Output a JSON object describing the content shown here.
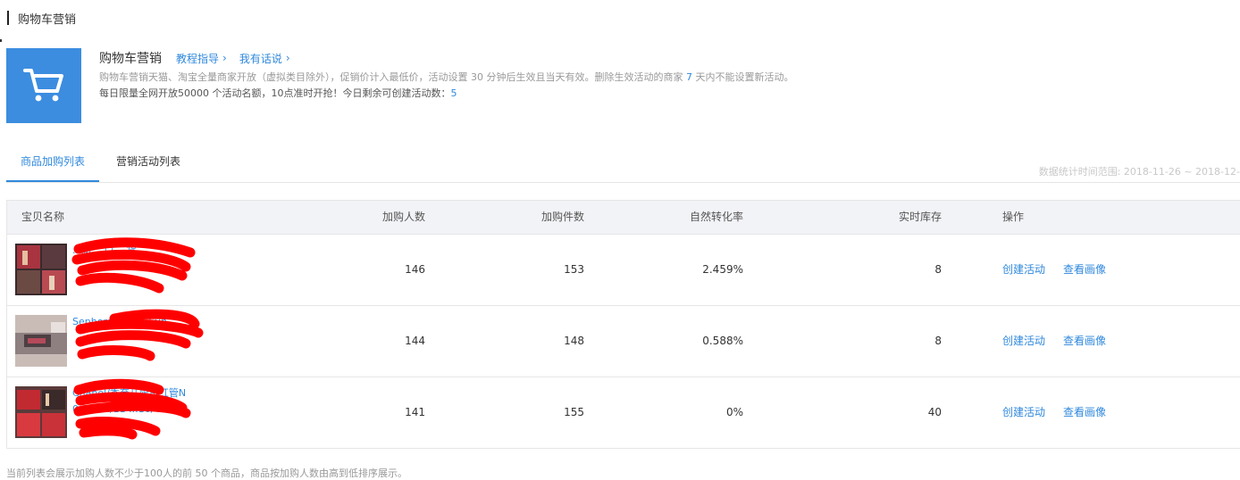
{
  "page": {
    "title": "购物车营销"
  },
  "promo": {
    "title": "购物车营销",
    "links": [
      "教程指导",
      "我有话说"
    ],
    "desc_pre": "购物车营销天猫、淘宝全量商家开放（虚拟类目除外），促销价计入最低价，活动设置 30 分钟后生效且当天有效。删除生效活动的商家 ",
    "desc_num": "7",
    "desc_post": " 天内不能设置新活动。",
    "quota_pre": "每日限量全网开放50000 个活动名额，10点准时开抢！今日剩余可创建活动数：",
    "quota_num": "5"
  },
  "tabs": [
    "商品加购列表",
    "营销活动列表"
  ],
  "stat_range": "数据统计时间范围: 2018-11-26 ~ 2018-12-",
  "table": {
    "headers": [
      "宝贝名称",
      "加购人数",
      "加购件数",
      "自然转化率",
      "实时库存",
      "操作"
    ],
    "rows": [
      {
        "name": "...新 ...口 ...货",
        "buyers": "146",
        "pieces": "153",
        "rate": "2.459%",
        "stock": "8"
      },
      {
        "name": "Sephora丝芙 ...3 un...",
        "buyers": "144",
        "pieces": "148",
        "rate": "0.588%",
        "stock": "8"
      },
      {
        "name": "Chanel/香奈儿限量红管N 0.15 ... /11 ...16/43/65...",
        "buyers": "141",
        "pieces": "155",
        "rate": "0%",
        "stock": "40"
      }
    ],
    "actions": [
      "创建活动",
      "查看画像"
    ]
  },
  "footer_note": "当前列表会展示加购人数不少于100人的前 50 个商品，商品按加购人数由高到低排序展示。",
  "colors": {
    "accent": "#3089dc",
    "cart_tile": "#3c8de0",
    "redaction": "#ff0000"
  },
  "icons": {
    "cart": "shopping-cart-icon",
    "chevron": "chevron-right-icon"
  }
}
